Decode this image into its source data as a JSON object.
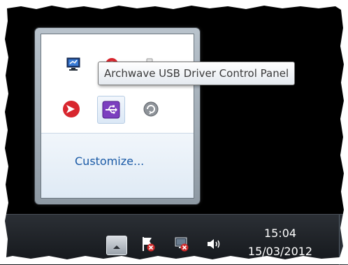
{
  "tooltip": {
    "text": "Archwave USB Driver Control Panel"
  },
  "tray_overflow": {
    "customize_label": "Customize...",
    "icons": [
      {
        "name": "network-monitor-icon"
      },
      {
        "name": "red-circle-icon"
      },
      {
        "name": "usb-driver-icon",
        "color": "#7c3fbf"
      },
      {
        "name": "avid-logo-icon",
        "color": "#d8262e"
      },
      {
        "name": "sync-icon"
      }
    ]
  },
  "taskbar": {
    "clock": {
      "time": "15:04",
      "date": "15/03/2012"
    }
  },
  "colors": {
    "link": "#1a5aa6",
    "usb_purple": "#7c3fbf",
    "avid_red": "#d8262e"
  }
}
